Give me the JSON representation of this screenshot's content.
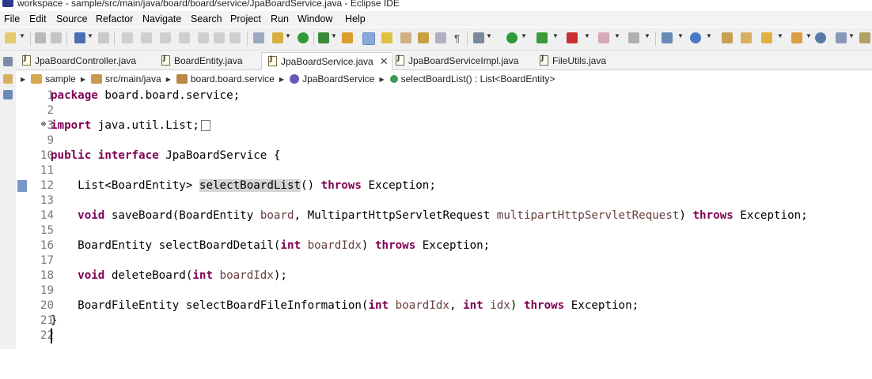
{
  "window": {
    "title": "workspace - sample/src/main/java/board/board/service/JpaBoardService.java - Eclipse IDE"
  },
  "menu": [
    "File",
    "Edit",
    "Source",
    "Refactor",
    "Navigate",
    "Search",
    "Project",
    "Run",
    "Window",
    "Help"
  ],
  "tabs": [
    {
      "label": "JpaBoardController.java",
      "active": false
    },
    {
      "label": "BoardEntity.java",
      "active": false
    },
    {
      "label": "JpaBoardService.java",
      "active": true
    },
    {
      "label": "JpaBoardServiceImpl.java",
      "active": false
    },
    {
      "label": "FileUtils.java",
      "active": false
    }
  ],
  "breadcrumb": [
    "sample",
    "src/main/java",
    "board.board.service",
    "JpaBoardService",
    "selectBoardList() : List<BoardEntity>"
  ],
  "code": {
    "l1": {
      "num": "1",
      "kw": "package",
      "rest": " board.board.service;"
    },
    "l2": {
      "num": "2"
    },
    "l3": {
      "num": "3",
      "kw": "import",
      "rest": " java.util.List;"
    },
    "l9": {
      "num": "9"
    },
    "l10": {
      "num": "10",
      "kw1": "public",
      "kw2": "interface",
      "rest": " JpaBoardService {"
    },
    "l11": {
      "num": "11"
    },
    "l12": {
      "num": "12",
      "a": "    List<BoardEntity> ",
      "hl": "selectBoardList",
      "b": "() ",
      "kw": "throws",
      "c": " Exception;"
    },
    "l13": {
      "num": "13"
    },
    "l14": {
      "num": "14",
      "kw": "void",
      "a": " saveBoard(BoardEntity ",
      "p1": "board",
      "b": ", MultipartHttpServletRequest ",
      "p2": "multipartHttpServletRequest",
      "c": ") ",
      "kw2": "throws",
      "d": " Exception;"
    },
    "l15": {
      "num": "15"
    },
    "l16": {
      "num": "16",
      "a": "    BoardEntity selectBoardDetail(",
      "kw": "int",
      "p1": " boardIdx",
      "b": ") ",
      "kw2": "throws",
      "c": " Exception;"
    },
    "l17": {
      "num": "17"
    },
    "l18": {
      "num": "18",
      "kw": "void",
      "a": " deleteBoard(",
      "kw2": "int",
      "p1": " boardIdx",
      "b": ");"
    },
    "l19": {
      "num": "19"
    },
    "l20": {
      "num": "20",
      "a": "    BoardFileEntity selectBoardFileInformation(",
      "kw": "int",
      "p1": " boardIdx",
      "b": ", ",
      "kw2": "int",
      "p2": " idx",
      "c": ") ",
      "kw3": "throws",
      "d": " Exception;"
    },
    "l21": {
      "num": "21",
      "rest": "}"
    },
    "l22": {
      "num": "22"
    }
  },
  "colors": {
    "keyword": "#7f0055",
    "parameter": "#6a3e3e",
    "line_number": "#787878",
    "highlight": "#d4d4d4"
  }
}
